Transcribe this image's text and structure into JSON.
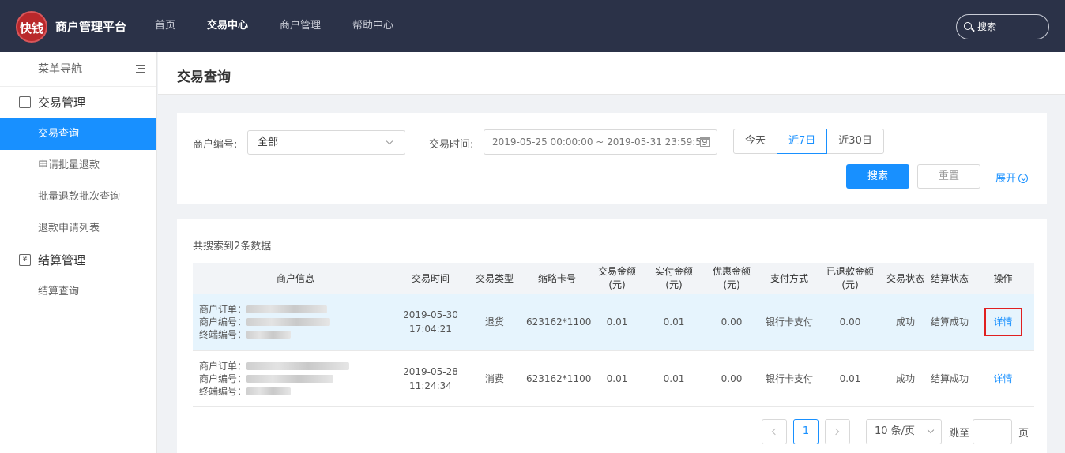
{
  "header": {
    "logo_text": "快钱",
    "brand": "商户管理平台",
    "nav": [
      {
        "label": "首页",
        "active": false
      },
      {
        "label": "交易中心",
        "active": true
      },
      {
        "label": "商户管理",
        "active": false
      },
      {
        "label": "帮助中心",
        "active": false
      }
    ],
    "search_placeholder": "搜索"
  },
  "sidebar": {
    "title": "菜单导航",
    "groups": [
      {
        "label": "交易管理",
        "icon": "list-icon",
        "items": [
          {
            "label": "交易查询",
            "active": true
          },
          {
            "label": "申请批量退款",
            "active": false
          },
          {
            "label": "批量退款批次查询",
            "active": false
          },
          {
            "label": "退款申请列表",
            "active": false
          }
        ]
      },
      {
        "label": "结算管理",
        "icon": "yen-icon",
        "items": [
          {
            "label": "结算查询",
            "active": false
          }
        ]
      }
    ]
  },
  "page": {
    "title": "交易查询"
  },
  "filter": {
    "merchant_label": "商户编号:",
    "merchant_value": "全部",
    "time_label": "交易时间:",
    "time_value": "2019-05-25 00:00:00 ~ 2019-05-31 23:59:59",
    "quick": [
      "今天",
      "近7日",
      "近30日"
    ],
    "quick_active": "近7日",
    "search_btn": "搜索",
    "reset_btn": "重置",
    "expand": "展开"
  },
  "results": {
    "count_text": "共搜索到2条数据",
    "columns": [
      "商户信息",
      "交易时间",
      "交易类型",
      "缩略卡号",
      "交易金额\n(元)",
      "实付金额\n(元)",
      "优惠金额\n(元)",
      "支付方式",
      "已退款金额\n(元)",
      "交易状态",
      "结算状态",
      "操作"
    ],
    "info_labels": [
      "商户订单：",
      "商户编号：",
      "终端编号："
    ],
    "rows": [
      {
        "time": "2019-05-30 17:04:21",
        "type": "退货",
        "card": "623162*1100",
        "amount": "0.01",
        "paid": "0.01",
        "discount": "0.00",
        "pay_method": "银行卡支付",
        "refunded": "0.00",
        "status": "成功",
        "settle": "结算成功",
        "action": "详情"
      },
      {
        "time": "2019-05-28 11:24:34",
        "type": "消费",
        "card": "623162*1100",
        "amount": "0.01",
        "paid": "0.01",
        "discount": "0.00",
        "pay_method": "银行卡支付",
        "refunded": "0.01",
        "status": "成功",
        "settle": "结算成功",
        "action": "详情"
      }
    ]
  },
  "pagination": {
    "current": "1",
    "page_size": "10 条/页",
    "jump_label": "跳至",
    "page_suffix": "页"
  },
  "colors": {
    "primary": "#1890ff",
    "topbar": "#2b3248",
    "highlight_border": "#e02020"
  }
}
